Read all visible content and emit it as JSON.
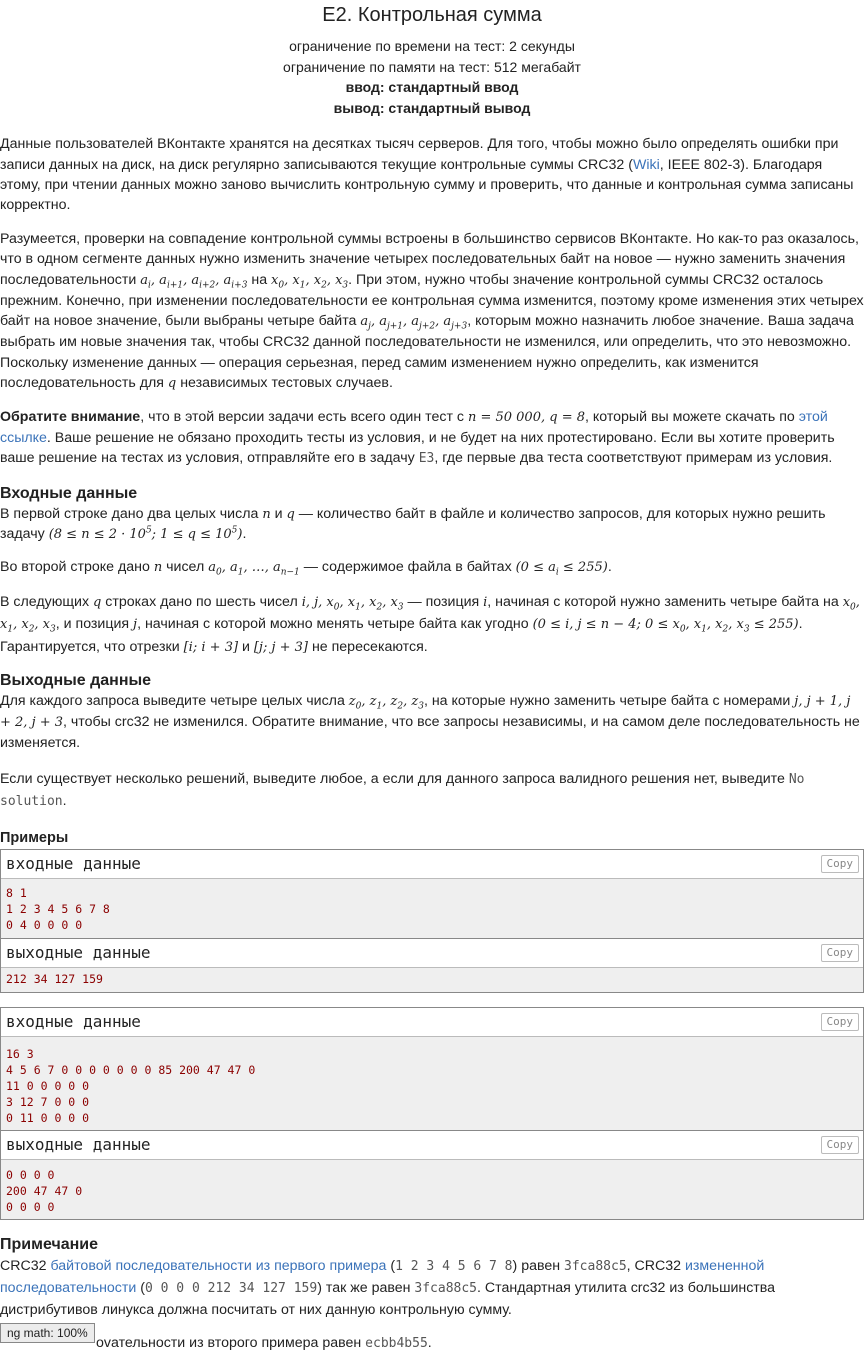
{
  "header": {
    "title": "E2. Контрольная сумма",
    "time_limit": "ограничение по времени на тест: 2 секунды",
    "memory_limit": "ограничение по памяти на тест: 512 мегабайт",
    "input": "ввод: стандартный ввод",
    "output": "вывод: стандартный вывод"
  },
  "legend": {
    "p1a": "Данные пользователей ВКонтакте хранятся на десятках тысяч серверов. Для того, чтобы можно было определять ошибки при записи данных на диск, на диск регулярно записываются текущие контрольные суммы CRC32 (",
    "wiki_link": "Wiki",
    "p1b": ", IEEE 802-3). Благодаря этому, при чтении данных можно заново вычислить контрольную сумму и проверить, что данные и контрольная сумма записаны корректно.",
    "p2a": "Разумеется, проверки на совпадение контрольной суммы встроены в большинство сервисов ВКонтакте. Но как-то раз оказалось, что в одном сегменте данных нужно изменить значение четырех последовательных байт на новое — нужно заменить значения последовательности ",
    "p2b": " на ",
    "p2c": ". При этом, нужно чтобы значение контрольной суммы CRC32 осталось прежним. Конечно, при изменении последовательности ее контрольная сумма изменится, поэтому кроме изменения этих четырех байт на новое значение, были выбраны четыре байта ",
    "p2d": ", которым можно назначить любое значение. Ваша задача выбрать им новые значения так, чтобы CRC32 данной последовательности не изменился, или определить, что это невозможно. Поскольку изменение данных — операция серьезная, перед самим изменением нужно определить, как изменится последовательность для ",
    "p2e": " независимых тестовых случаев.",
    "p3_bold": "Обратите внимание",
    "p3a": ", что в этой версии задачи есть всего один тест с ",
    "p3b": ", который вы можете скачать по ",
    "p3_link": "этой ссылке",
    "p3c": ". Ваше решение не обязано проходить тесты из условия, и не будет на них протестировано. Если вы хотите проверить ваше решение на тестах из условия, отправляйте его в задачу ",
    "p3_code": "E3",
    "p3d": ", где первые два теста соответствуют примерам из условия."
  },
  "input_spec": {
    "title": "Входные данные",
    "p1a": "В первой строке дано два целых числа ",
    "p1b": " и ",
    "p1c": " — количество байт в файле и количество запросов, для которых нужно решить задачу ",
    "p2a": "Во второй строке дано ",
    "p2b": " чисел ",
    "p2c": " — содержимое файла в байтах ",
    "p3a": "В следующих ",
    "p3b": " строках дано по шесть чисел ",
    "p3c": " — позиция ",
    "p3d": ", начиная с которой нужно заменить четыре байта на ",
    "p3e": ", и позиция ",
    "p3f": ", начиная с которой можно менять четыре байта как угодно ",
    "p3g": ". Гарантируется, что отрезки ",
    "p3h": " и ",
    "p3i": " не пересекаются."
  },
  "output_spec": {
    "title": "Выходные данные",
    "p1a": "Для каждого запроса выведите четыре целых числа ",
    "p1b": ", на которые нужно заменить четыре байта с номерами ",
    "p1c": ", чтобы crc32 не изменился. Обратите внимание, что все запросы независимы, и на самом деле последовательность не изменяется.",
    "p2a": "Если существует несколько решений, выведите любое, а если для данного запроса валидного решения нет, выведите ",
    "p2_code": "No solution",
    "p2b": "."
  },
  "examples": {
    "title": "Примеры",
    "input_label": "входные данные",
    "output_label": "выходные данные",
    "copy_label": "Copy",
    "tests": [
      {
        "input": "8 1\n1 2 3 4 5 6 7 8\n0 4 0 0 0 0",
        "output": "212 34 127 159"
      },
      {
        "input": "16 3\n4 5 6 7 0 0 0 0 0 0 0 85 200 47 47 0\n11 0 0 0 0 0\n3 12 7 0 0 0\n0 11 0 0 0 0",
        "output": "0 0 0 0\n200 47 47 0\n0 0 0 0"
      }
    ]
  },
  "note": {
    "title": "Примечание",
    "p1a": "CRC32 ",
    "p1_link1": "байтовой последовательности из первого примера",
    "p1_code1": "1 2 3 4 5 6 7 8",
    "p1b": " равен ",
    "p1_code2": "3fca88c5",
    "p1c": ", CRC32 ",
    "p1_link2": "измененной последовательности",
    "p1_code3": "0 0 0 0 212 34 127 159",
    "p1d": " так же равен ",
    "p1_code4": "3fca88c5",
    "p1e": ". Стандартная утилита crc32 из большинства дистрибутивов линукса должна посчитать от них данную контрольную сумму.",
    "p2a": "ovательности из второго примера равен ",
    "p2_code": "ecbb4b55",
    "p2b": "."
  },
  "status_bar": "ng math: 100%"
}
